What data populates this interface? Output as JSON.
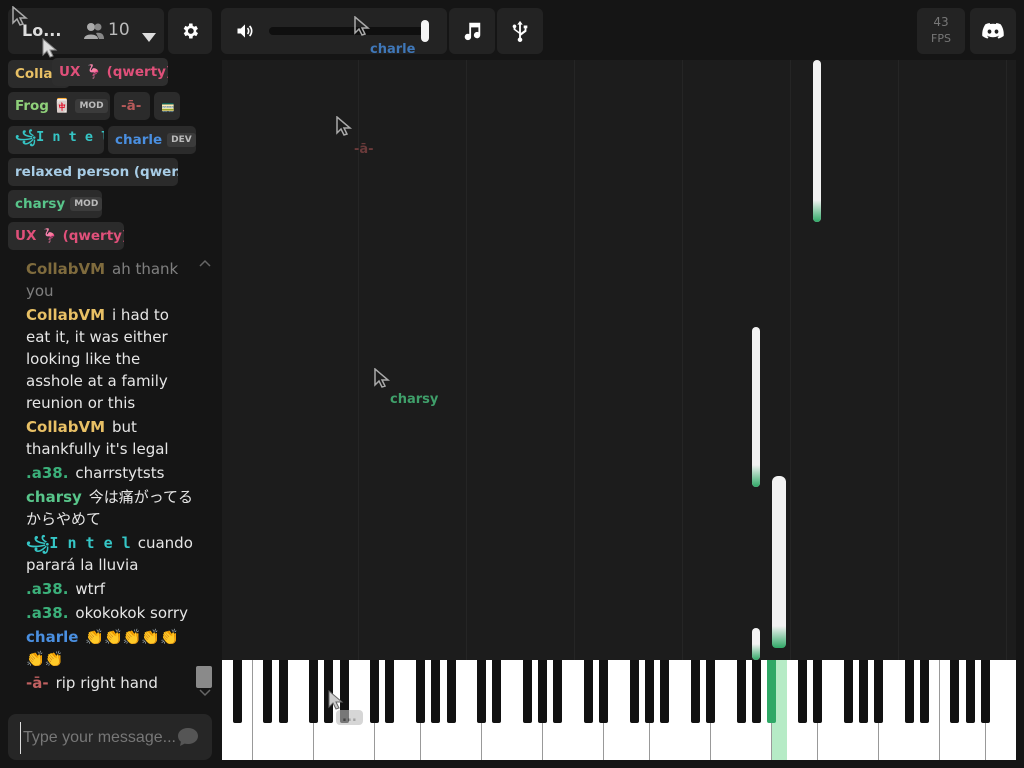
{
  "header": {
    "room_name": "Lo...",
    "user_count": "10",
    "fps_value": "43",
    "fps_label": "FPS"
  },
  "users": [
    {
      "name": "Collab",
      "color": "#e8c065",
      "badge": ""
    },
    {
      "name": "UX 🦩 (qwerty)",
      "color": "#e0507a",
      "badge": ""
    },
    {
      "name": "Frog 🀄",
      "color": "#8fd07a",
      "badge": "MOD"
    },
    {
      "name": "-ā-",
      "color": "#b85a5a",
      "badge": ""
    },
    {
      "name": "🚃",
      "color": "#dddddd",
      "badge": ""
    },
    {
      "name": "꧁I n t e l",
      "color": "#35c6c6",
      "badge": ""
    },
    {
      "name": "charle",
      "color": "#4a8fe0",
      "badge": "DEV"
    },
    {
      "name": "relaxed person (qwer...",
      "color": "#a8cde6",
      "badge": ""
    },
    {
      "name": "charsy",
      "color": "#58c58a",
      "badge": "MOD"
    },
    {
      "name": "UX 🦩 (qwerty)",
      "color": "#e0507a",
      "badge": ""
    }
  ],
  "chat": {
    "messages": [
      {
        "user": "CollabVM",
        "color": "#e8c065",
        "text": "ah thank you"
      },
      {
        "user": "CollabVM",
        "color": "#e8c065",
        "text": "i had to eat it, it was either looking like the asshole at a family reunion or this"
      },
      {
        "user": "CollabVM",
        "color": "#e8c065",
        "text": "but thankfully it's legal"
      },
      {
        "user": ".a38.",
        "color": "#3bb07a",
        "text": "charrstytsts"
      },
      {
        "user": "charsy",
        "color": "#58c58a",
        "text": "今は痛がってるからやめて"
      },
      {
        "user": "꧁I n t e l",
        "color": "#35c6c6",
        "text": "cuando parará la lluvia"
      },
      {
        "user": ".a38.",
        "color": "#3bb07a",
        "text": "wtrf"
      },
      {
        "user": ".a38.",
        "color": "#3bb07a",
        "text": "okokokok sorry"
      },
      {
        "user": "charle",
        "color": "#4a8fe0",
        "text": "👏👏👏👏👏👏👏"
      },
      {
        "user": "-ā-",
        "color": "#c06060",
        "text": "rip right hand"
      }
    ],
    "input_placeholder": "Type your message..."
  },
  "cursors": [
    {
      "label": "charle",
      "color": "#3f77b8"
    },
    {
      "label": "-ā-",
      "color": "#6a3a3a"
    },
    {
      "label": "charsy",
      "color": "#3f9f6a"
    },
    {
      "label": "...",
      "color": "#666666"
    }
  ],
  "icons": {
    "users": "users-icon",
    "dropdown": "chevron-down-icon",
    "settings": "gear-icon",
    "volume": "volume-icon",
    "music": "music-note-icon",
    "usb": "usb-icon",
    "discord": "discord-icon",
    "send": "chat-bubble-icon"
  },
  "colors": {
    "accent_green": "#2fa866",
    "active_key": "#b6ebc6"
  }
}
